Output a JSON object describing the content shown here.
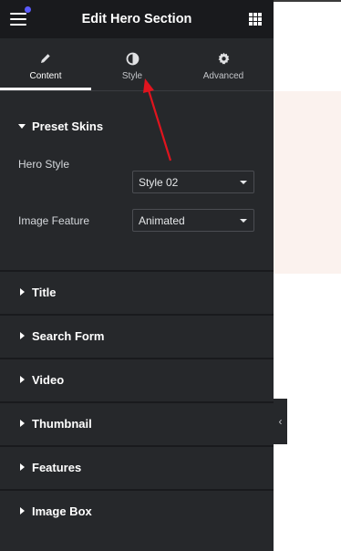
{
  "header": {
    "title": "Edit Hero Section",
    "menu_icon": "hamburger-icon",
    "apps_icon": "grid-icon"
  },
  "tabs": [
    {
      "label": "Content",
      "icon": "pencil-icon",
      "active": true
    },
    {
      "label": "Style",
      "icon": "contrast-icon",
      "active": false
    },
    {
      "label": "Advanced",
      "icon": "gear-icon",
      "active": false
    }
  ],
  "preset_skins": {
    "title": "Preset Skins",
    "hero_style_label": "Hero Style",
    "hero_style_value": "Style 02",
    "image_feature_label": "Image Feature",
    "image_feature_value": "Animated"
  },
  "sections": [
    {
      "title": "Title"
    },
    {
      "title": "Search Form"
    },
    {
      "title": "Video"
    },
    {
      "title": "Thumbnail"
    },
    {
      "title": "Features"
    },
    {
      "title": "Image Box"
    }
  ],
  "colors": {
    "panel": "#26282b",
    "header": "#191a1d",
    "arrow": "#e0141e",
    "canvas_hero": "#fbf2ee"
  }
}
